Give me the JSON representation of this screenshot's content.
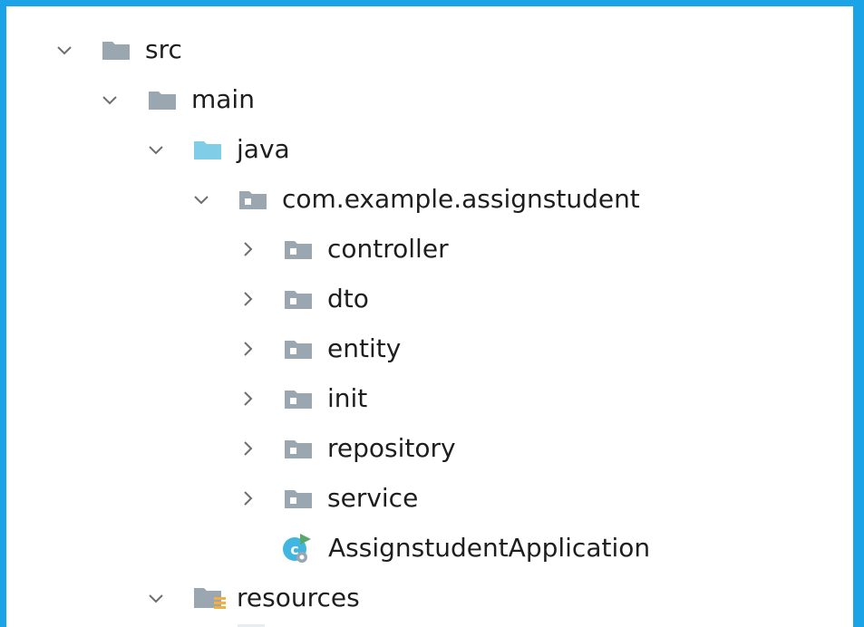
{
  "tree": {
    "nodes": [
      {
        "label": "src",
        "icon": "folder-icon",
        "expanded": true
      },
      {
        "label": "main",
        "icon": "folder-icon",
        "expanded": true
      },
      {
        "label": "java",
        "icon": "source-root-folder-icon",
        "expanded": true
      },
      {
        "label": "com.example.assignstudent",
        "icon": "package-icon",
        "expanded": true
      },
      {
        "label": "controller",
        "icon": "package-icon",
        "expanded": false
      },
      {
        "label": "dto",
        "icon": "package-icon",
        "expanded": false
      },
      {
        "label": "entity",
        "icon": "package-icon",
        "expanded": false
      },
      {
        "label": "init",
        "icon": "package-icon",
        "expanded": false
      },
      {
        "label": "repository",
        "icon": "package-icon",
        "expanded": false
      },
      {
        "label": "service",
        "icon": "package-icon",
        "expanded": false
      },
      {
        "label": "AssignstudentApplication",
        "icon": "spring-boot-class-icon"
      },
      {
        "label": "resources",
        "icon": "resources-folder-icon",
        "expanded": true
      }
    ]
  },
  "colors": {
    "frame_border": "#1aa3e6",
    "folder_gray": "#9aa7b0",
    "source_folder_blue": "#80cde8",
    "class_teal": "#40b6e0",
    "run_green": "#59a869",
    "resources_yellow": "#f4af3d"
  }
}
